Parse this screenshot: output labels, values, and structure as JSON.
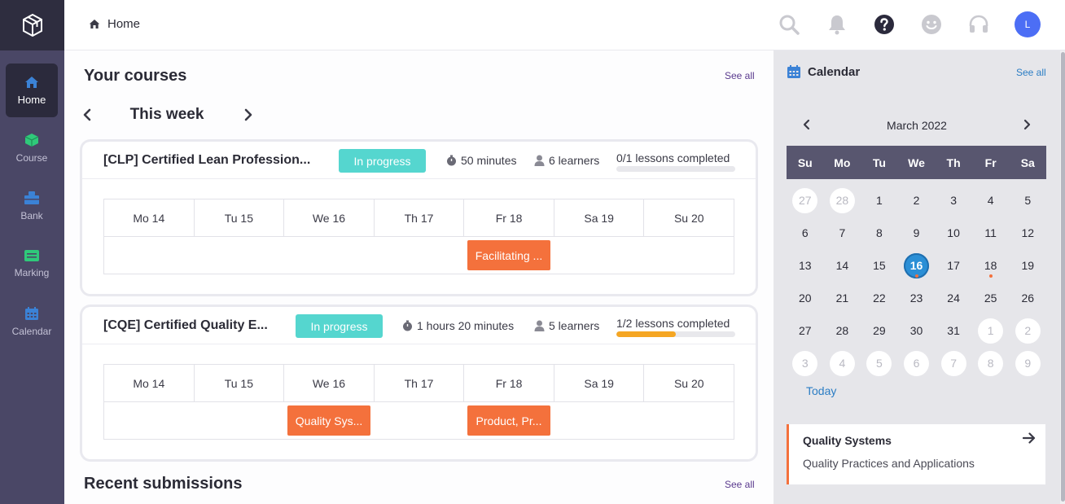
{
  "sidebar": {
    "items": [
      {
        "label": "Home",
        "icon": "home-icon",
        "color": "#3b82d6"
      },
      {
        "label": "Course",
        "icon": "cube-icon",
        "color": "#2fc97a"
      },
      {
        "label": "Bank",
        "icon": "bank-icon",
        "color": "#3b82d6"
      },
      {
        "label": "Marking",
        "icon": "marking-icon",
        "color": "#2fc97a"
      },
      {
        "label": "Calendar",
        "icon": "calendar-icon",
        "color": "#3b82d6"
      }
    ]
  },
  "header": {
    "breadcrumb": "Home",
    "avatar_initial": "L",
    "icons": [
      "search-icon",
      "bell-icon",
      "help-icon",
      "smiley-icon",
      "headset-icon"
    ]
  },
  "main": {
    "courses_title": "Your courses",
    "courses_see_all": "See all",
    "week_title": "This week",
    "submissions_title": "Recent submissions",
    "submissions_see_all": "See all",
    "courses": [
      {
        "title": "[CLP] Certified Lean Profession...",
        "status": "In progress",
        "duration": "50 minutes",
        "learners": "6 learners",
        "lessons": "0/1 lessons completed",
        "progress": 0,
        "days": [
          "Mo 14",
          "Tu 15",
          "We 16",
          "Th 17",
          "Fr 18",
          "Sa 19",
          "Su 20"
        ],
        "events": [
          {
            "label": "Facilitating ...",
            "day_index": 4
          }
        ]
      },
      {
        "title": "[CQE] Certified Quality E...",
        "status": "In progress",
        "duration": "1 hours 20 minutes",
        "learners": "5 learners",
        "lessons": "1/2 lessons completed",
        "progress": 0.5,
        "days": [
          "Mo 14",
          "Tu 15",
          "We 16",
          "Th 17",
          "Fr 18",
          "Sa 19",
          "Su 20"
        ],
        "events": [
          {
            "label": "Quality Sys...",
            "day_index": 2
          },
          {
            "label": "Product, Pr...",
            "day_index": 4
          }
        ]
      }
    ]
  },
  "calendar": {
    "title": "Calendar",
    "see_all": "See all",
    "month": "March 2022",
    "weekdays": [
      "Su",
      "Mo",
      "Tu",
      "We",
      "Th",
      "Fr",
      "Sa"
    ],
    "weeks": [
      [
        "27",
        "28",
        "1",
        "2",
        "3",
        "4",
        "5"
      ],
      [
        "6",
        "7",
        "8",
        "9",
        "10",
        "11",
        "12"
      ],
      [
        "13",
        "14",
        "15",
        "16",
        "17",
        "18",
        "19"
      ],
      [
        "20",
        "21",
        "22",
        "23",
        "24",
        "25",
        "26"
      ],
      [
        "27",
        "28",
        "29",
        "30",
        "31",
        "1",
        "2"
      ],
      [
        "3",
        "4",
        "5",
        "6",
        "7",
        "8",
        "9"
      ]
    ],
    "today": "16",
    "event_days": [
      "16",
      "18"
    ],
    "today_label": "Today",
    "event": {
      "title": "Quality Systems",
      "subtitle": "Quality Practices and Applications"
    }
  }
}
